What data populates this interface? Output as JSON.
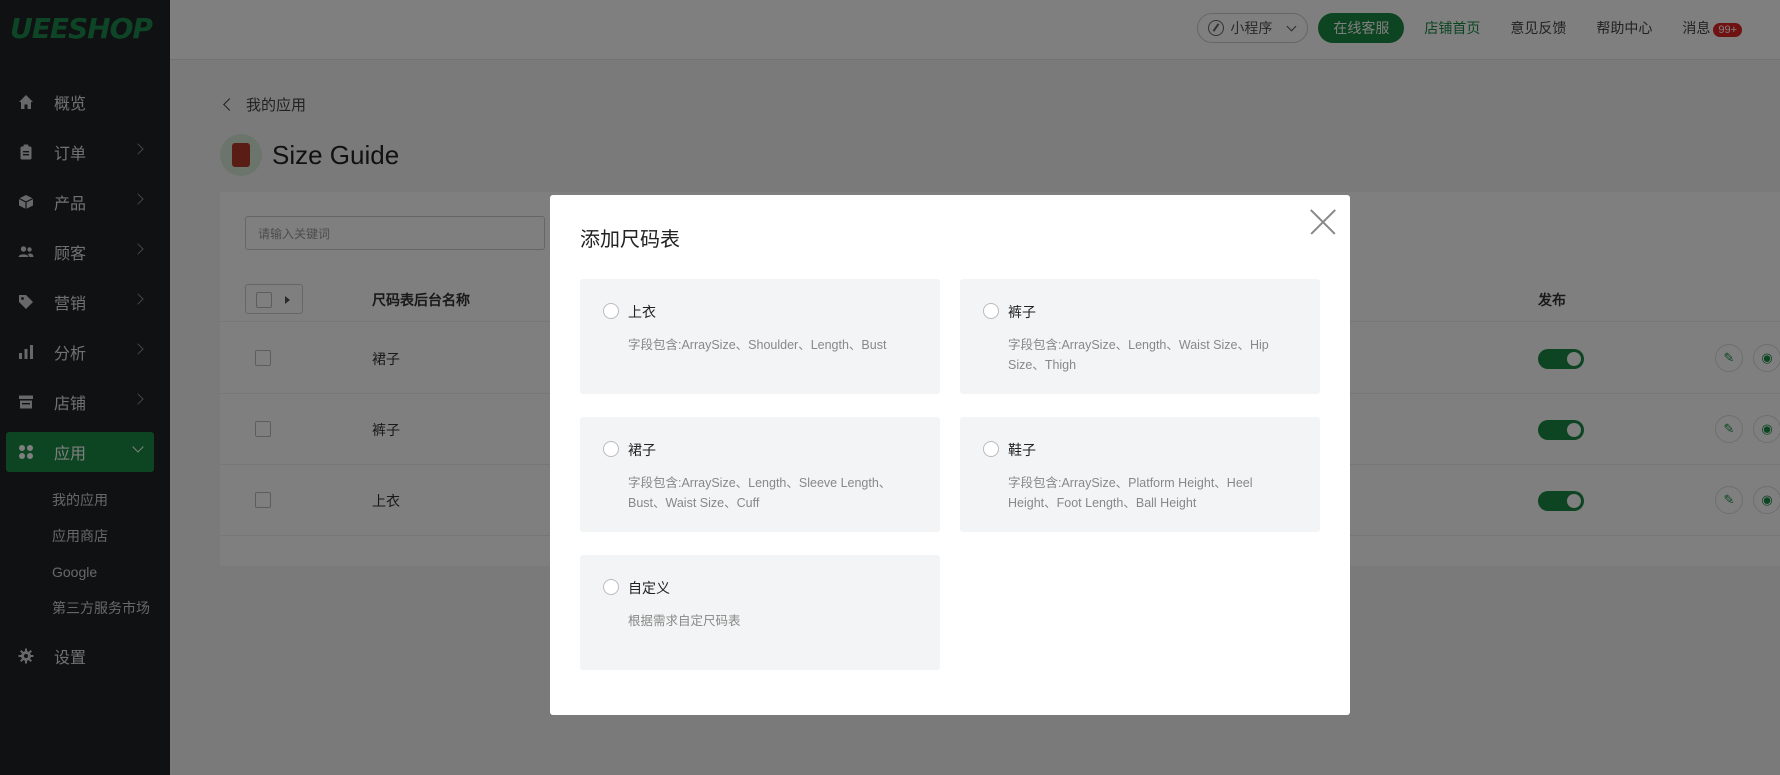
{
  "logo": "UEESHOP",
  "sidebar": {
    "items": [
      {
        "label": "概览",
        "icon": "home-icon"
      },
      {
        "label": "订单",
        "icon": "clipboard-icon"
      },
      {
        "label": "产品",
        "icon": "box-icon"
      },
      {
        "label": "顾客",
        "icon": "users-icon"
      },
      {
        "label": "营销",
        "icon": "tag-icon"
      },
      {
        "label": "分析",
        "icon": "bar-chart-icon"
      },
      {
        "label": "店铺",
        "icon": "store-icon"
      },
      {
        "label": "应用",
        "icon": "apps-icon",
        "active": true
      },
      {
        "label": "设置",
        "icon": "gear-icon"
      }
    ],
    "app_subitems": [
      "我的应用",
      "应用商店",
      "Google",
      "第三方服务市场"
    ]
  },
  "topbar": {
    "mini_program": "小程序",
    "online_service": "在线客服",
    "store_home": "店铺首页",
    "feedback": "意见反馈",
    "help": "帮助中心",
    "messages": "消息",
    "messages_badge": "99+"
  },
  "page": {
    "back_label": "我的应用",
    "title": "Size Guide",
    "search_placeholder": "请输入关键词",
    "columns": {
      "name": "尺码表后台名称",
      "publish": "发布"
    },
    "rows": [
      {
        "name": "裙子",
        "published": true
      },
      {
        "name": "裤子",
        "published": true
      },
      {
        "name": "上衣",
        "published": true
      }
    ]
  },
  "modal": {
    "title": "添加尺码表",
    "options": [
      {
        "title": "上衣",
        "desc": "字段包含:ArraySize、Shoulder、Length、Bust"
      },
      {
        "title": "裤子",
        "desc": "字段包含:ArraySize、Length、Waist Size、Hip Size、Thigh"
      },
      {
        "title": "裙子",
        "desc": "字段包含:ArraySize、Length、Sleeve Length、Bust、Waist Size、Cuff"
      },
      {
        "title": "鞋子",
        "desc": "字段包含:ArraySize、Platform Height、Heel Height、Foot Length、Ball Height"
      },
      {
        "title": "自定义",
        "desc": "根据需求自定尺码表"
      }
    ]
  },
  "colors": {
    "brand_green": "#1a8a44",
    "sidebar_bg": "#1f2327",
    "badge_red": "#e02424"
  }
}
